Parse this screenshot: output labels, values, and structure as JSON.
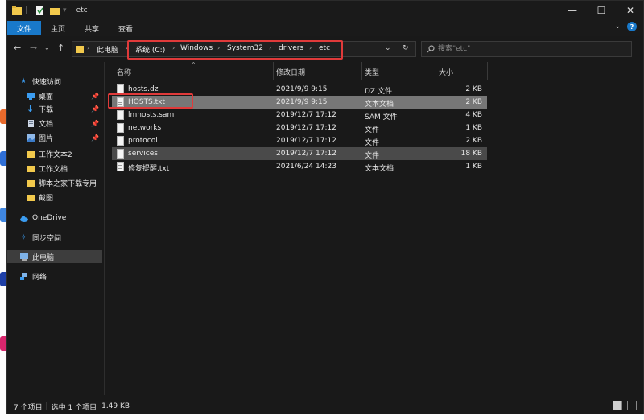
{
  "window": {
    "title": "etc"
  },
  "ribbon": {
    "tabs": [
      "文件",
      "主页",
      "共享",
      "查看"
    ],
    "active_tab": "文件"
  },
  "address": {
    "crumbs": [
      "此电脑",
      "系统 (C:)",
      "Windows",
      "System32",
      "drivers",
      "etc"
    ]
  },
  "search": {
    "placeholder": "搜索\"etc\""
  },
  "sidebar": {
    "items": [
      {
        "label": "快速访问",
        "icon": "star-icon",
        "pinned": false
      },
      {
        "label": "桌面",
        "icon": "desktop-icon",
        "pinned": true
      },
      {
        "label": "下载",
        "icon": "download-icon",
        "pinned": true
      },
      {
        "label": "文档",
        "icon": "document-icon",
        "pinned": true
      },
      {
        "label": "图片",
        "icon": "picture-icon",
        "pinned": true
      },
      {
        "label": "工作文本2",
        "icon": "folder-icon",
        "pinned": false
      },
      {
        "label": "工作文档",
        "icon": "folder-icon",
        "pinned": false
      },
      {
        "label": "脚本之家下载专用",
        "icon": "folder-icon",
        "pinned": false
      },
      {
        "label": "截图",
        "icon": "folder-icon",
        "pinned": false
      },
      {
        "label": "OneDrive",
        "icon": "cloud-icon",
        "pinned": false
      },
      {
        "label": "同步空间",
        "icon": "sync-icon",
        "pinned": false
      },
      {
        "label": "此电脑",
        "icon": "computer-icon",
        "pinned": false
      },
      {
        "label": "网络",
        "icon": "network-icon",
        "pinned": false
      }
    ]
  },
  "columns": [
    "名称",
    "修改日期",
    "类型",
    "大小"
  ],
  "files": [
    {
      "name": "hosts.dz",
      "modified": "2021/9/9 9:15",
      "type": "DZ 文件",
      "size": "2 KB"
    },
    {
      "name": "HOSTS.txt",
      "modified": "2021/9/9 9:15",
      "type": "文本文档",
      "size": "2 KB"
    },
    {
      "name": "lmhosts.sam",
      "modified": "2019/12/7 17:12",
      "type": "SAM 文件",
      "size": "4 KB"
    },
    {
      "name": "networks",
      "modified": "2019/12/7 17:12",
      "type": "文件",
      "size": "1 KB"
    },
    {
      "name": "protocol",
      "modified": "2019/12/7 17:12",
      "type": "文件",
      "size": "2 KB"
    },
    {
      "name": "services",
      "modified": "2019/12/7 17:12",
      "type": "文件",
      "size": "18 KB"
    },
    {
      "name": "修复提醒.txt",
      "modified": "2021/6/24 14:23",
      "type": "文本文档",
      "size": "1 KB"
    }
  ],
  "status": {
    "count": "7 个项目",
    "selection": "选中 1 个项目",
    "size": "1.49 KB"
  },
  "colors": {
    "accent": "#1979ca",
    "highlight": "#e03a3a",
    "selected_row": "#777777"
  }
}
